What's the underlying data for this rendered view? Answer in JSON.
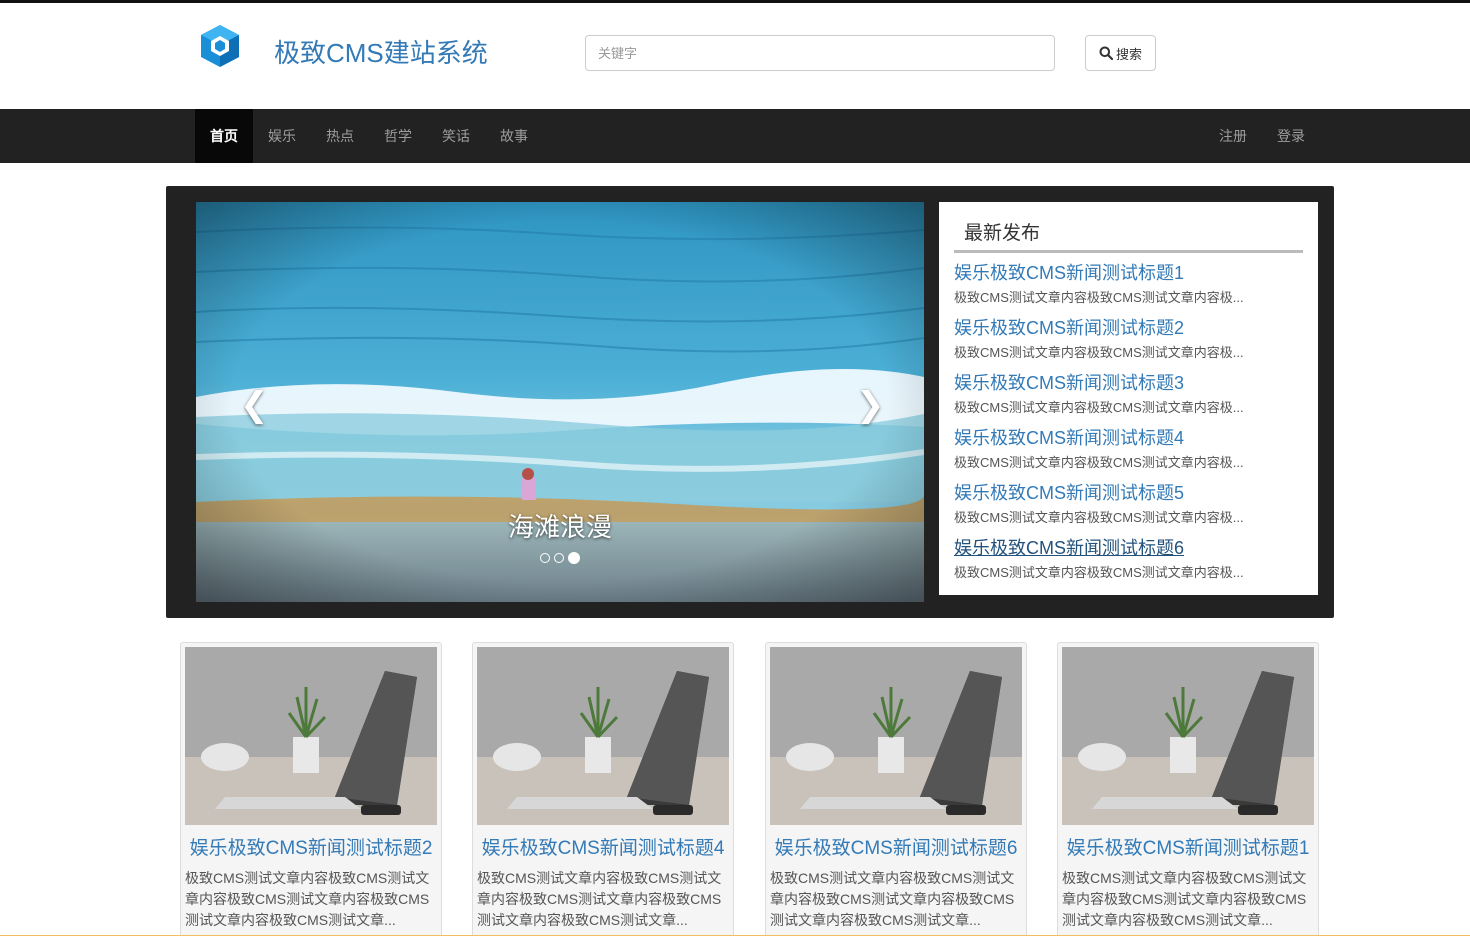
{
  "header": {
    "site_title": "极致CMS建站系统",
    "search_placeholder": "关键字",
    "search_button": "搜索"
  },
  "nav": {
    "left": [
      {
        "label": "首页",
        "active": true
      },
      {
        "label": "娱乐"
      },
      {
        "label": "热点"
      },
      {
        "label": "哲学"
      },
      {
        "label": "笑话"
      },
      {
        "label": "故事"
      }
    ],
    "right": [
      {
        "label": "注册"
      },
      {
        "label": "登录"
      }
    ]
  },
  "carousel": {
    "caption": "海滩浪漫",
    "slide_count": 3,
    "active_slide": 3
  },
  "latest": {
    "title": "最新发布",
    "items": [
      {
        "title": "娱乐极致CMS新闻测试标题1",
        "summary": "极致CMS测试文章内容极致CMS测试文章内容极..."
      },
      {
        "title": "娱乐极致CMS新闻测试标题2",
        "summary": "极致CMS测试文章内容极致CMS测试文章内容极..."
      },
      {
        "title": "娱乐极致CMS新闻测试标题3",
        "summary": "极致CMS测试文章内容极致CMS测试文章内容极..."
      },
      {
        "title": "娱乐极致CMS新闻测试标题4",
        "summary": "极致CMS测试文章内容极致CMS测试文章内容极..."
      },
      {
        "title": "娱乐极致CMS新闻测试标题5",
        "summary": "极致CMS测试文章内容极致CMS测试文章内容极..."
      },
      {
        "title": "娱乐极致CMS新闻测试标题6",
        "summary": "极致CMS测试文章内容极致CMS测试文章内容极..."
      }
    ]
  },
  "cards": [
    {
      "title": "娱乐极致CMS新闻测试标题2",
      "desc": "极致CMS测试文章内容极致CMS测试文章内容极致CMS测试文章内容极致CMS测试文章内容极致CMS测试文章..."
    },
    {
      "title": "娱乐极致CMS新闻测试标题4",
      "desc": "极致CMS测试文章内容极致CMS测试文章内容极致CMS测试文章内容极致CMS测试文章内容极致CMS测试文章..."
    },
    {
      "title": "娱乐极致CMS新闻测试标题6",
      "desc": "极致CMS测试文章内容极致CMS测试文章内容极致CMS测试文章内容极致CMS测试文章内容极致CMS测试文章..."
    },
    {
      "title": "娱乐极致CMS新闻测试标题1",
      "desc": "极致CMS测试文章内容极致CMS测试文章内容极致CMS测试文章内容极致CMS测试文章内容极致CMS测试文章..."
    }
  ],
  "colors": {
    "link": "#337ab7",
    "navbar": "#222222",
    "nav_active": "#080808",
    "banner_bg": "#222222"
  }
}
